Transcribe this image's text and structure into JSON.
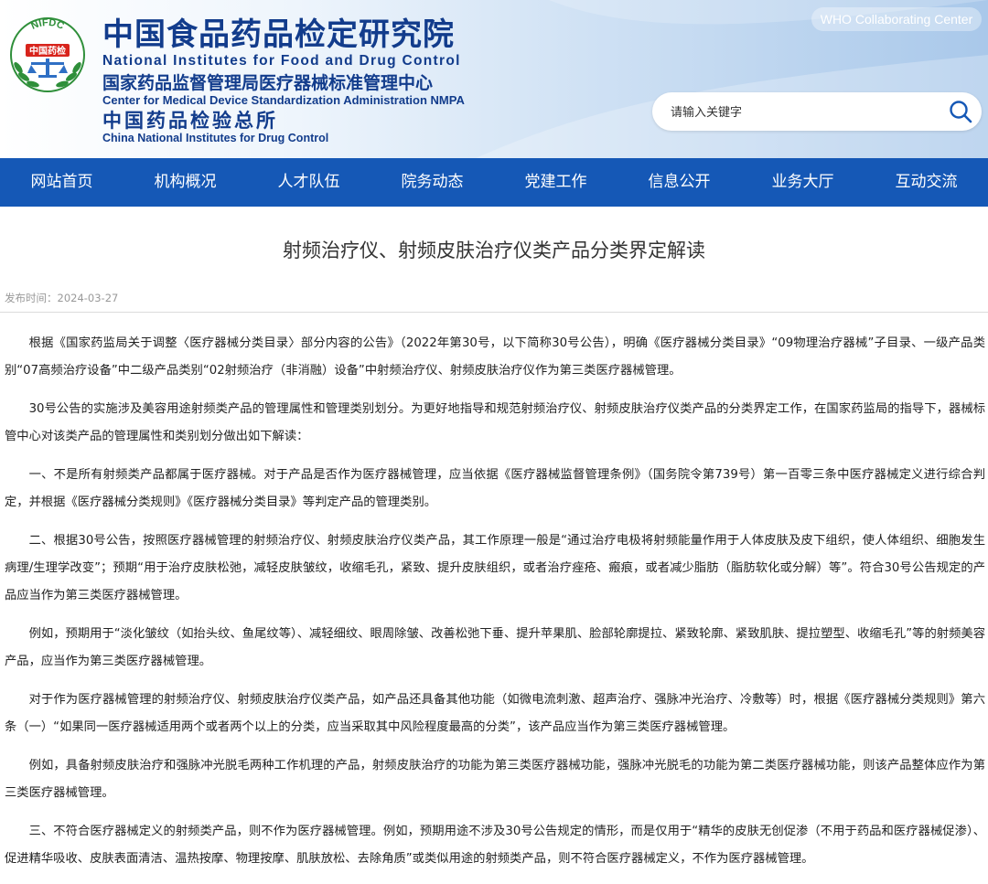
{
  "header": {
    "logo_text_top": "NIFDC",
    "logo_text_inner": "中国药检",
    "brand_cn_main": "中国食品药品检定研究院",
    "brand_en_main": "National Institutes for Food and Drug Control",
    "brand_cn_sub": "国家药品监督管理局医疗器械标准管理中心",
    "brand_en_sub": "Center for Medical Device Standardization Administration NMPA",
    "brand_cn_sub2": "中国药品检验总所",
    "brand_en_sub2": "China National Institutes for Drug Control",
    "who_badge": "WHO Collaborating Center",
    "search": {
      "placeholder": "请输入关键字",
      "icon": "search-icon"
    }
  },
  "nav": {
    "items": [
      "网站首页",
      "机构概况",
      "人才队伍",
      "院务动态",
      "党建工作",
      "信息公开",
      "业务大厅",
      "互动交流"
    ]
  },
  "article": {
    "title": "射频治疗仪、射频皮肤治疗仪类产品分类界定解读",
    "publish_time": "发布时间：2024-03-27",
    "paragraphs": [
      "根据《国家药监局关于调整〈医疗器械分类目录〉部分内容的公告》（2022年第30号，以下简称30号公告），明确《医疗器械分类目录》“09物理治疗器械”子目录、一级产品类别“07高频治疗设备”中二级产品类别“02射频治疗（非消融）设备”中射频治疗仪、射频皮肤治疗仪作为第三类医疗器械管理。",
      "30号公告的实施涉及美容用途射频类产品的管理属性和管理类别划分。为更好地指导和规范射频治疗仪、射频皮肤治疗仪类产品的分类界定工作，在国家药监局的指导下，器械标管中心对该类产品的管理属性和类别划分做出如下解读：",
      "一、不是所有射频类产品都属于医疗器械。对于产品是否作为医疗器械管理，应当依据《医疗器械监督管理条例》（国务院令第739号）第一百零三条中医疗器械定义进行综合判定，并根据《医疗器械分类规则》《医疗器械分类目录》等判定产品的管理类别。",
      "二、根据30号公告，按照医疗器械管理的射频治疗仪、射频皮肤治疗仪类产品，其工作原理一般是“通过治疗电极将射频能量作用于人体皮肤及皮下组织，使人体组织、细胞发生病理/生理学改变”；预期“用于治疗皮肤松弛，减轻皮肤皱纹，收缩毛孔，紧致、提升皮肤组织，或者治疗痤疮、瘢痕，或者减少脂肪（脂肪软化或分解）等”。符合30号公告规定的产品应当作为第三类医疗器械管理。",
      "例如，预期用于“淡化皱纹（如抬头纹、鱼尾纹等）、减轻细纹、眼周除皱、改善松弛下垂、提升苹果肌、脸部轮廓提拉、紧致轮廓、紧致肌肤、提拉塑型、收缩毛孔”等的射频美容产品，应当作为第三类医疗器械管理。",
      "对于作为医疗器械管理的射频治疗仪、射频皮肤治疗仪类产品，如产品还具备其他功能（如微电流刺激、超声治疗、强脉冲光治疗、冷敷等）时，根据《医疗器械分类规则》第六条（一）“如果同一医疗器械适用两个或者两个以上的分类，应当采取其中风险程度最高的分类”，该产品应当作为第三类医疗器械管理。",
      "例如，具备射频皮肤治疗和强脉冲光脱毛两种工作机理的产品，射频皮肤治疗的功能为第三类医疗器械功能，强脉冲光脱毛的功能为第二类医疗器械功能，则该产品整体应作为第三类医疗器械管理。",
      "三、不符合医疗器械定义的射频类产品，则不作为医疗器械管理。例如，预期用途不涉及30号公告规定的情形，而是仅用于“精华的皮肤无创促渗（不用于药品和医疗器械促渗）、促进精华吸收、皮肤表面清洁、温热按摩、物理按摩、肌肤放松、去除角质”或类似用途的射频类产品，则不符合医疗器械定义，不作为医疗器械管理。"
    ]
  },
  "colors": {
    "brand_blue": "#123c8c",
    "nav_blue": "#1558b6",
    "logo_green": "#2f8f3a",
    "logo_red": "#d8241c"
  }
}
